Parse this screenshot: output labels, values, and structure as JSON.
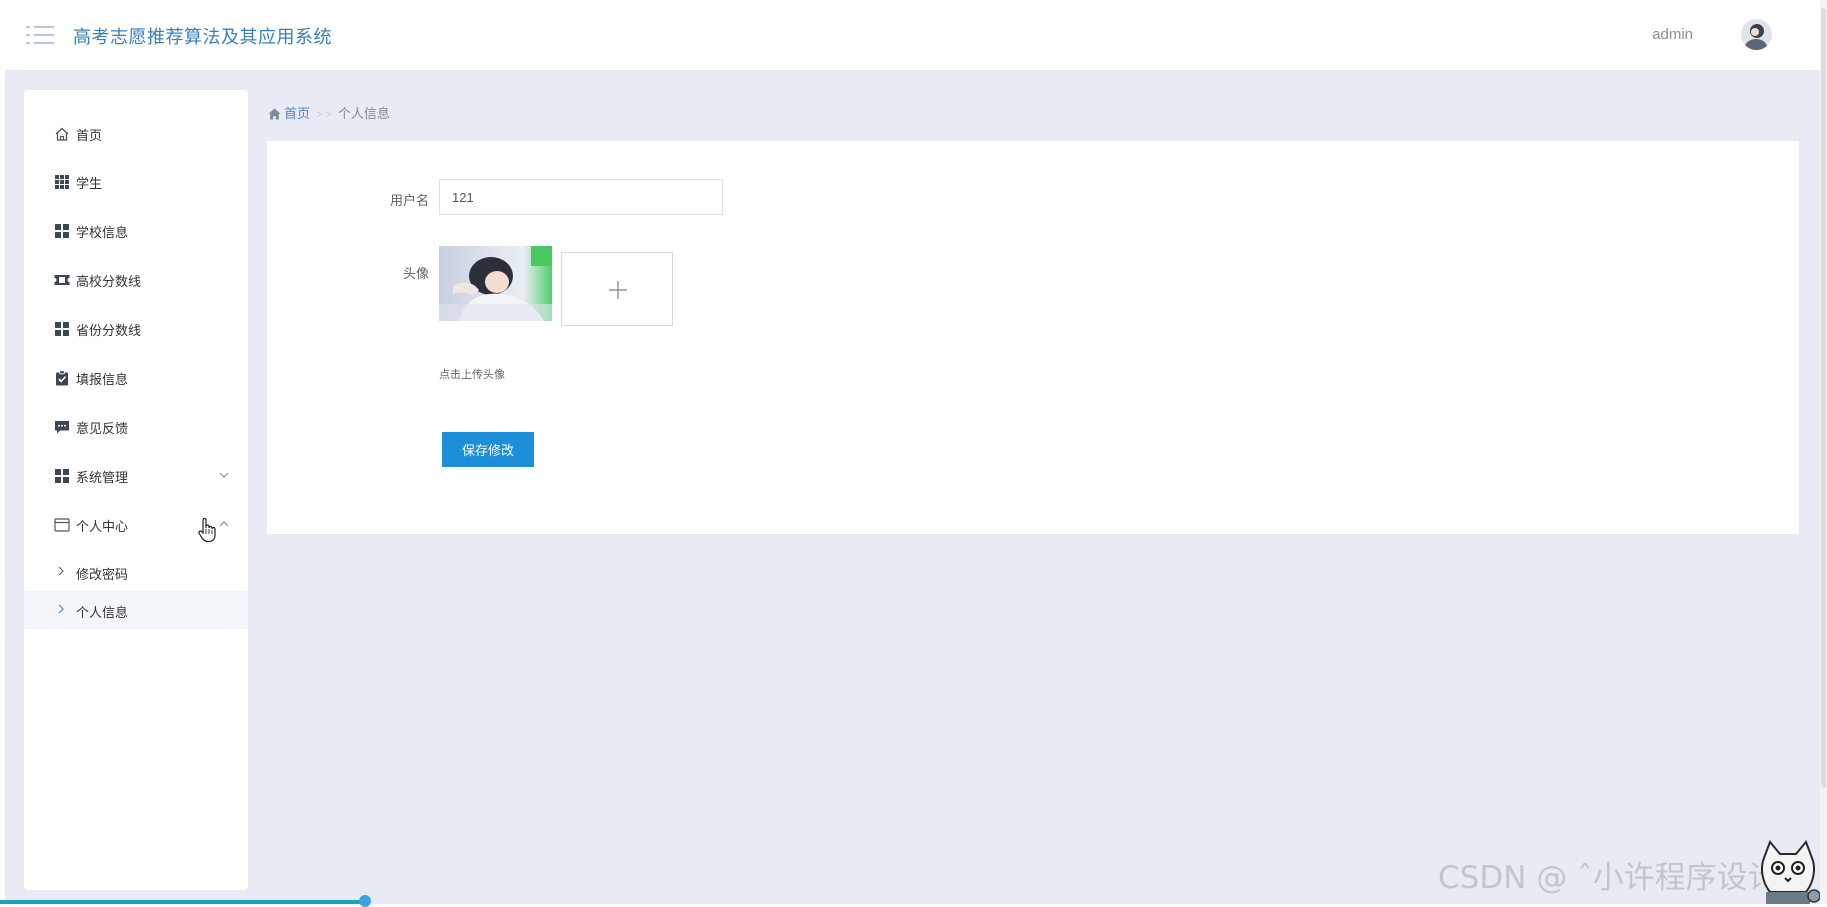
{
  "header": {
    "app_title": "高考志愿推荐算法及其应用系统",
    "username": "admin"
  },
  "sidebar": {
    "items": [
      {
        "label": "首页",
        "icon": "home-icon"
      },
      {
        "label": "学生",
        "icon": "grid-icon"
      },
      {
        "label": "学校信息",
        "icon": "apps-icon"
      },
      {
        "label": "高校分数线",
        "icon": "ticket-icon"
      },
      {
        "label": "省份分数线",
        "icon": "apps-icon"
      },
      {
        "label": "填报信息",
        "icon": "clipboard-check-icon"
      },
      {
        "label": "意见反馈",
        "icon": "message-icon"
      },
      {
        "label": "系统管理",
        "icon": "apps-icon",
        "expandable": true,
        "expanded": false
      },
      {
        "label": "个人中心",
        "icon": "window-icon",
        "expandable": true,
        "expanded": true
      }
    ],
    "sub_items": [
      {
        "label": "修改密码",
        "active": false
      },
      {
        "label": "个人信息",
        "active": true
      }
    ]
  },
  "breadcrumb": {
    "home": "首页",
    "separator": "> >",
    "current": "个人信息"
  },
  "form": {
    "username_label": "用户名",
    "username_value": "121",
    "avatar_label": "头像",
    "upload_hint": "点击上传头像",
    "save_label": "保存修改"
  },
  "watermark": "CSDN @ ˆ小许程序设计",
  "colors": {
    "accent": "#1c8fd8",
    "title": "#3a7fb8",
    "background": "#e8ebf3",
    "sidebar_active": "#f3f6fb"
  }
}
